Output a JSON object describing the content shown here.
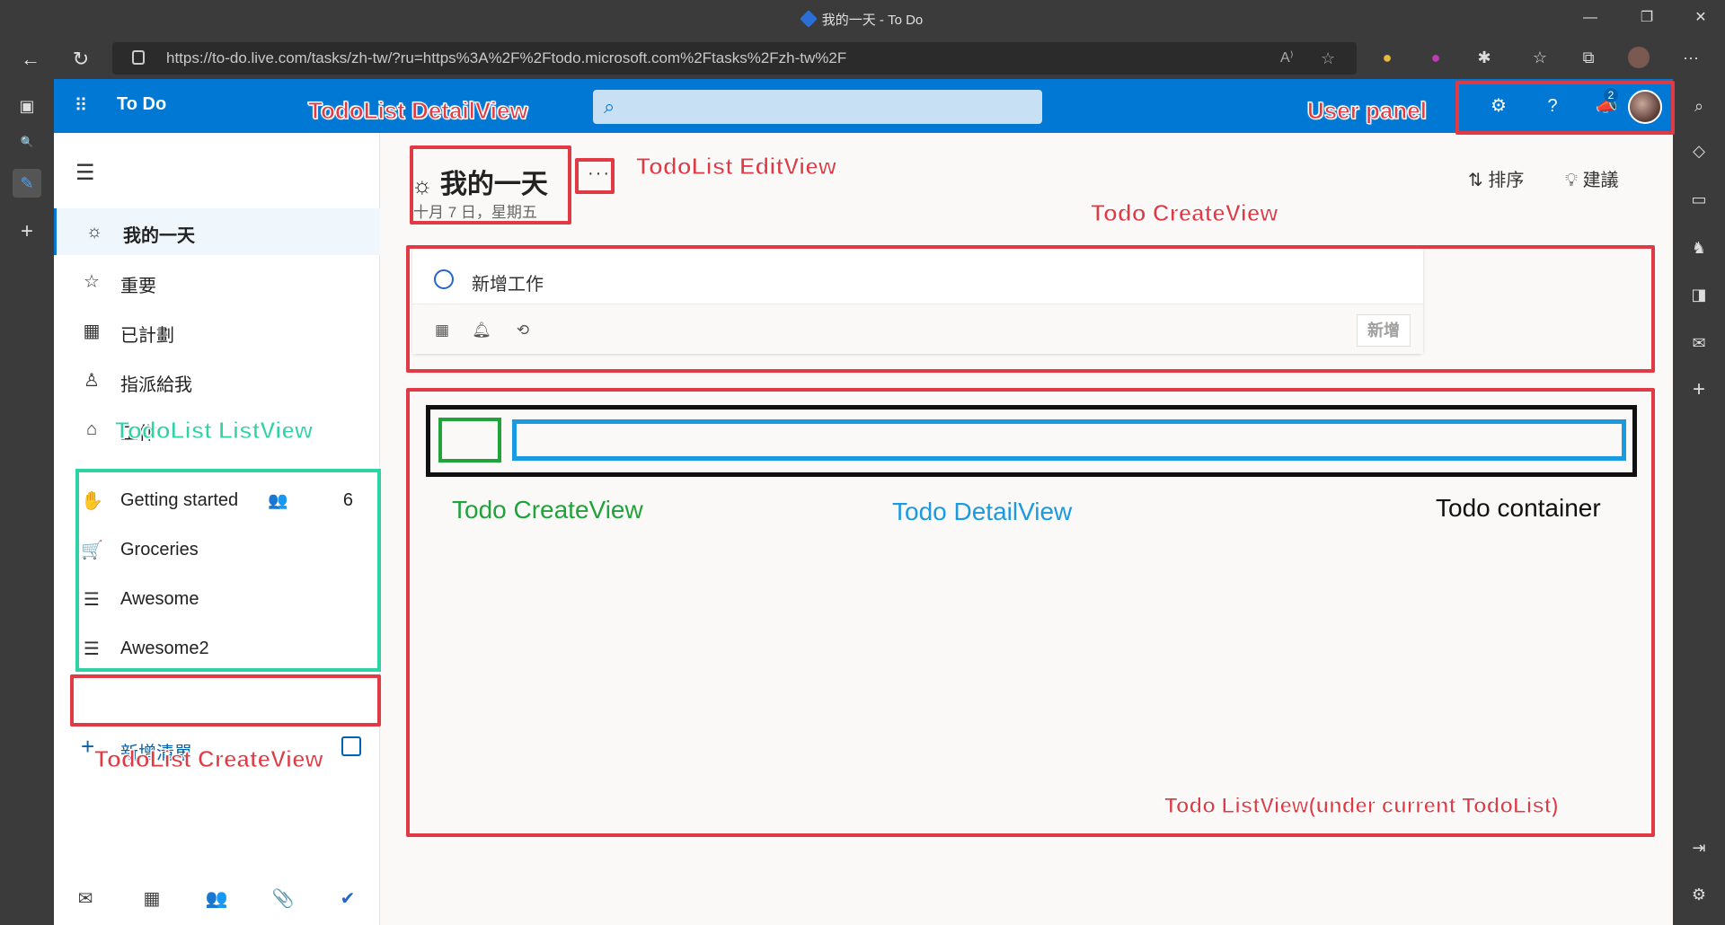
{
  "browser": {
    "window_title": "我的一天 - To Do",
    "url": "https://to-do.live.com/tasks/zh-tw/?ru=https%3A%2F%2Ftodo.microsoft.com%2Ftasks%2Fzh-tw%2F"
  },
  "app": {
    "name": "To Do",
    "notification_count": "2"
  },
  "nav": {
    "items": [
      {
        "label": "我的一天",
        "icon": "sun-icon"
      },
      {
        "label": "重要",
        "icon": "star-icon"
      },
      {
        "label": "已計劃",
        "icon": "calendar-icon"
      },
      {
        "label": "指派給我",
        "icon": "person-icon"
      },
      {
        "label": "工作",
        "icon": "home-icon"
      }
    ],
    "lists": [
      {
        "label": "Getting started",
        "count": "6",
        "icon": "hand-wave-icon"
      },
      {
        "label": "Groceries",
        "icon": "cart-icon"
      },
      {
        "label": "Awesome",
        "icon": "list-icon"
      },
      {
        "label": "Awesome2",
        "icon": "list-icon"
      }
    ],
    "add_list_label": "新增清單"
  },
  "main": {
    "title": "我的一天",
    "date": "十月 7 日，星期五",
    "more": "···",
    "sort_label": "排序",
    "suggest_label": "建議",
    "add_task_placeholder": "新增工作",
    "add_button": "新增"
  },
  "annotations": {
    "todolist_detailview": "TodoList DetailView",
    "todolist_editview": "TodoList EditView",
    "user_panel": "User panel",
    "todo_createview_top": "Todo CreateView",
    "todolist_listview": "TodoList ListView",
    "todolist_createview": "TodoList CreateView",
    "todo_createview": "Todo CreateView",
    "todo_detailview": "Todo DetailView",
    "todo_container": "Todo container",
    "todo_listview": "Todo ListView(under current TodoList)"
  },
  "colors": {
    "accent": "#0078d4",
    "annotation_red": "#e03a44",
    "annotation_green": "#1fa33a",
    "annotation_blue": "#1a9ae0",
    "annotation_teal": "#2ed3a5"
  }
}
